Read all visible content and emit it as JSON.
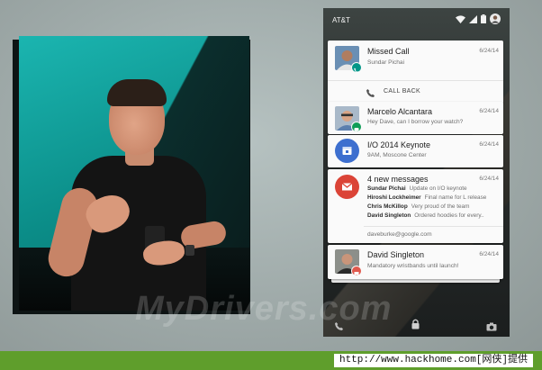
{
  "status_bar": {
    "carrier": "AT&T"
  },
  "notifications": {
    "missed_call": {
      "title": "Missed Call",
      "subtitle": "Sundar Pichai",
      "time": "6/24/14",
      "action_label": "CALL BACK"
    },
    "hangouts": {
      "title": "Marcelo Alcantara",
      "subtitle": "Hey Dave, can I borrow your watch?",
      "time": "6/24/14"
    },
    "calendar": {
      "title": "I/O 2014 Keynote",
      "subtitle": "9AM, Moscone Center",
      "time": "6/24/14"
    },
    "gmail": {
      "title": "4 new messages",
      "time": "6/24/14",
      "lines": [
        {
          "sender": "Sundar Pichai",
          "text": "Update on I/O keynote"
        },
        {
          "sender": "Hiroshi Lockheimer",
          "text": "Final name for L release"
        },
        {
          "sender": "Chris McKillop",
          "text": "Very proud of the team"
        },
        {
          "sender": "David Singleton",
          "text": "Ordered hoodies for every.."
        }
      ],
      "account": "daveburke@google.com"
    },
    "sms": {
      "title": "David Singleton",
      "subtitle": "Mandatory wristbands until launch!",
      "time": "6/24/14"
    }
  },
  "watermark": "MyDrivers.com",
  "footer": {
    "text": "http://www.hackhome.com[网侠]提供"
  },
  "colors": {
    "calendar_blue": "#3d6fcf",
    "gmail_red": "#db4437",
    "hangouts_green": "#0f9d58",
    "phone_teal": "#009688",
    "footer_green": "#5f9e2c"
  }
}
